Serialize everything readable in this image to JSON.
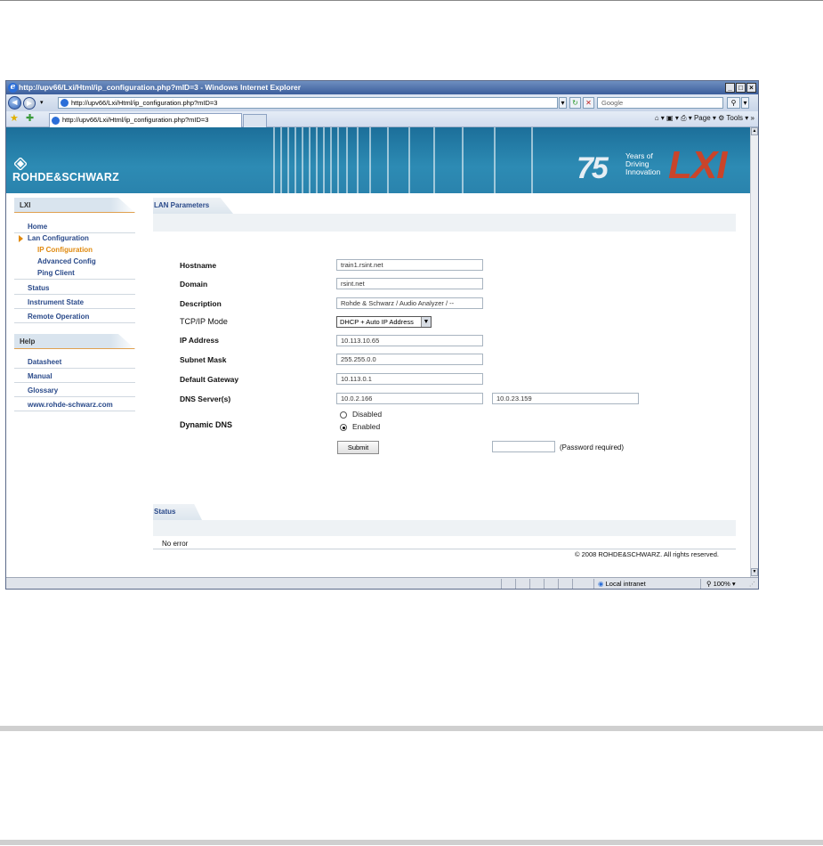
{
  "window": {
    "title": "http://upv66/Lxi/Html/ip_configuration.php?mID=3 - Windows Internet Explorer",
    "min_label": "_",
    "max_label": "□",
    "close_label": "×"
  },
  "address_bar": {
    "url": "http://upv66/Lxi/Html/ip_configuration.php?mID=3",
    "search_placeholder": "Google"
  },
  "tab": {
    "label": "http://upv66/Lxi/Html/ip_configuration.php?mID=3"
  },
  "command_bar": {
    "page_label": "Page",
    "tools_label": "Tools"
  },
  "header": {
    "brand": "ROHDE&SCHWARZ",
    "anniversary_number": "75",
    "anniversary_line1": "Years of",
    "anniversary_line2": "Driving",
    "anniversary_line3": "Innovation",
    "lxi_logo": "LXI"
  },
  "sidebar": {
    "lxi_heading": "LXI",
    "items": [
      {
        "label": "Home"
      },
      {
        "label": "Lan Configuration"
      },
      {
        "label": "IP Configuration"
      },
      {
        "label": "Advanced Config"
      },
      {
        "label": "Ping Client"
      },
      {
        "label": "Status"
      },
      {
        "label": "Instrument State"
      },
      {
        "label": "Remote Operation"
      }
    ],
    "help_heading": "Help",
    "help_items": [
      {
        "label": "Datasheet"
      },
      {
        "label": "Manual"
      },
      {
        "label": "Glossary"
      },
      {
        "label": "www.rohde-schwarz.com"
      }
    ]
  },
  "lan": {
    "section_title": "LAN Parameters",
    "hostname_label": "Hostname",
    "hostname_value": "train1.rsint.net",
    "domain_label": "Domain",
    "domain_value": "rsint.net",
    "description_label": "Description",
    "description_value": "Rohde & Schwarz / Audio Analyzer / --",
    "tcpip_label": "TCP/IP Mode",
    "tcpip_value": "DHCP + Auto IP Address",
    "ip_label": "IP Address",
    "ip_value": "10.113.10.65",
    "subnet_label": "Subnet Mask",
    "subnet_value": "255.255.0.0",
    "gateway_label": "Default Gateway",
    "gateway_value": "10.113.0.1",
    "dns_label": "DNS Server(s)",
    "dns1_value": "10.0.2.166",
    "dns2_value": "10.0.23.159",
    "ddns_label": "Dynamic DNS",
    "ddns_disabled": "Disabled",
    "ddns_enabled": "Enabled",
    "submit_label": "Submit",
    "password_note": "(Password required)"
  },
  "status": {
    "section_title": "Status",
    "message": "No error",
    "copyright": "© 2008 ROHDE&SCHWARZ. All rights reserved."
  },
  "statusbar": {
    "zone": "Local intranet",
    "zoom": "100%"
  }
}
